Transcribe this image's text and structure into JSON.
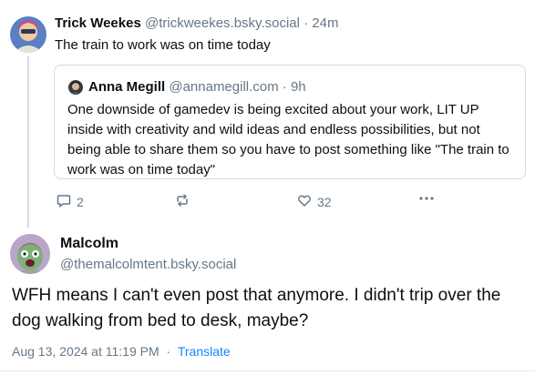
{
  "parent_post": {
    "author_name": "Trick Weekes",
    "author_handle": "@trickweekes.bsky.social",
    "time": "· 24m",
    "text": "The train to work was on time today",
    "quote": {
      "author_name": "Anna Megill",
      "author_handle": "@annamegill.com",
      "time": "· 9h",
      "text": "One downside of gamedev is being excited about your work, LIT UP inside with creativity and wild ideas and endless possibilities, but not being able to share them so you have to post something like \"The train to work was on time today\""
    },
    "actions": {
      "reply_count": "2",
      "repost_count": "",
      "like_count": "32",
      "more_icon": "ellipsis-icon"
    }
  },
  "main_post": {
    "author_name": "Malcolm",
    "author_handle": "@themalcolmtent.bsky.social",
    "text": "WFH means I can't even post that anymore. I didn't trip over the dog walking from bed to desk, maybe?",
    "timestamp": "Aug 13, 2024 at 11:19 PM",
    "separator": "·",
    "translate_label": "Translate"
  },
  "colors": {
    "accent": "#1185fe",
    "muted": "#667788",
    "border": "#d4dbe2"
  }
}
